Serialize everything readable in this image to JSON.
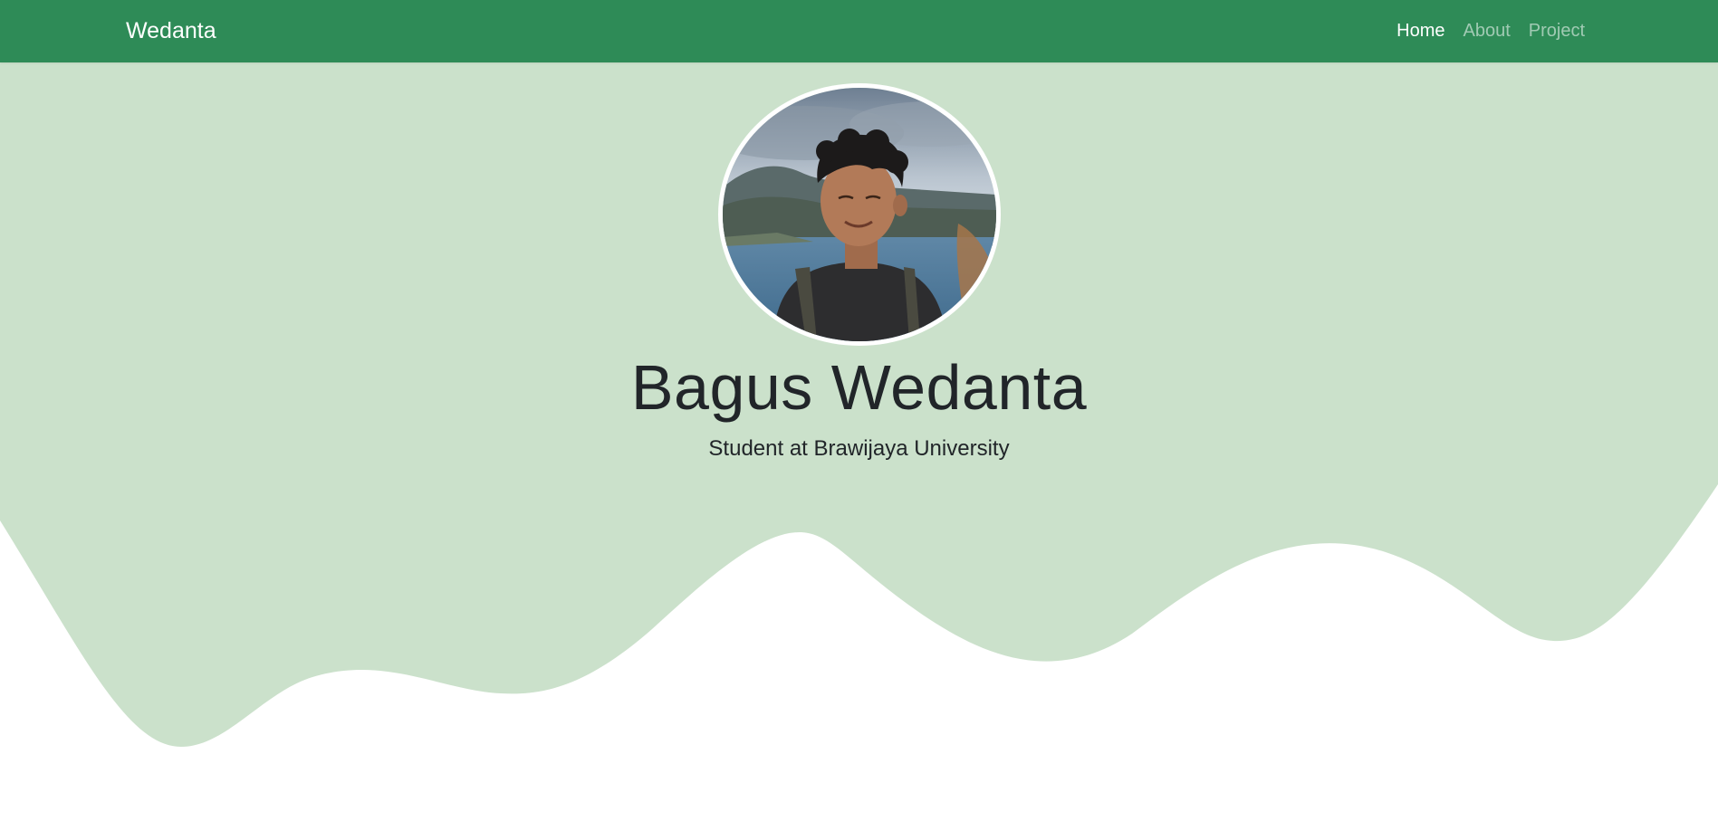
{
  "navbar": {
    "brand": "Wedanta",
    "links": [
      {
        "label": "Home",
        "active": true
      },
      {
        "label": "About",
        "active": false
      },
      {
        "label": "Project",
        "active": false
      }
    ]
  },
  "hero": {
    "name": "Bagus Wedanta",
    "tagline": "Student at Brawijaya University",
    "avatar_icon": "profile-photo"
  },
  "colors": {
    "navbar_bg": "#2e8b57",
    "hero_bg": "#cbe1cb",
    "page_bg": "#ffffff",
    "text": "#212529"
  }
}
